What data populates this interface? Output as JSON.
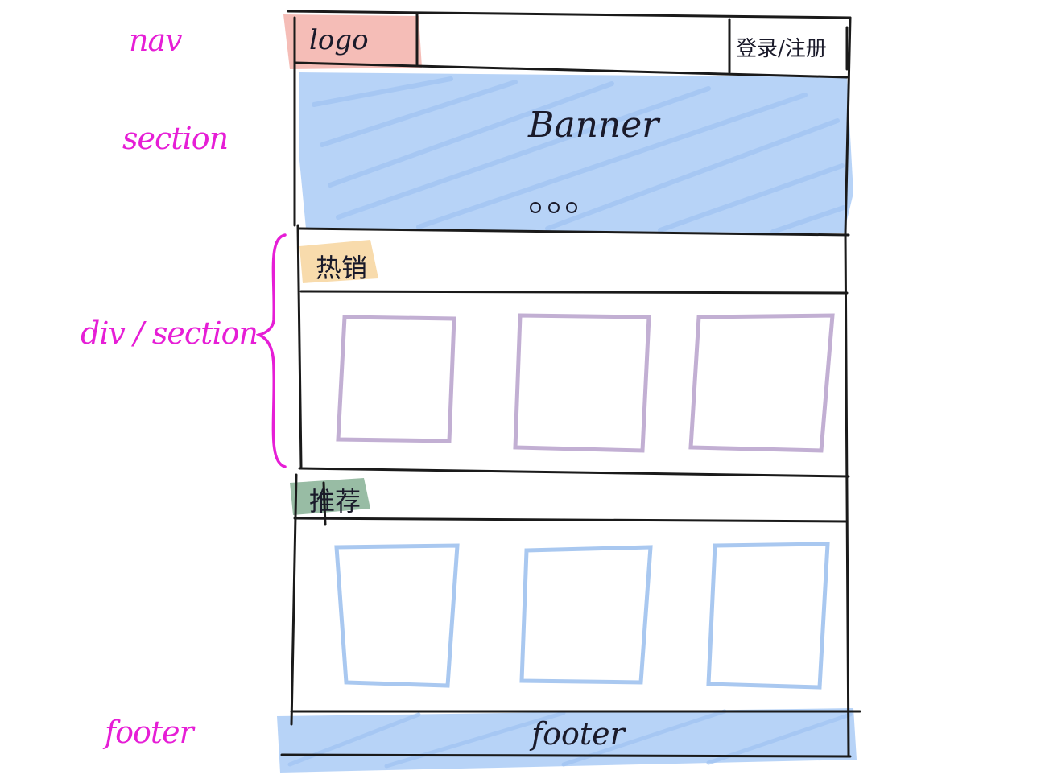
{
  "side_labels": {
    "nav": "nav",
    "section": "section",
    "div_section": "div / section",
    "footer": "footer"
  },
  "nav": {
    "logo": "logo",
    "login_register": "登录/注册"
  },
  "banner": {
    "title": "Banner",
    "indicator_count": 3
  },
  "hot_section": {
    "title": "热销",
    "card_count": 3
  },
  "recommend_section": {
    "title": "推荐",
    "card_count": 3
  },
  "footer": {
    "text": "footer"
  },
  "colors": {
    "ink": "#1a1a1a",
    "annotation": "#e61ed6",
    "logo_highlight": "#f4b9b3",
    "banner_fill": "#b3d1f7",
    "hot_highlight": "#f8d9a8",
    "hot_cards": "#c2afd3",
    "recommend_highlight": "#8db59a",
    "recommend_cards": "#a9c8f0",
    "footer_fill": "#b3d1f7"
  }
}
